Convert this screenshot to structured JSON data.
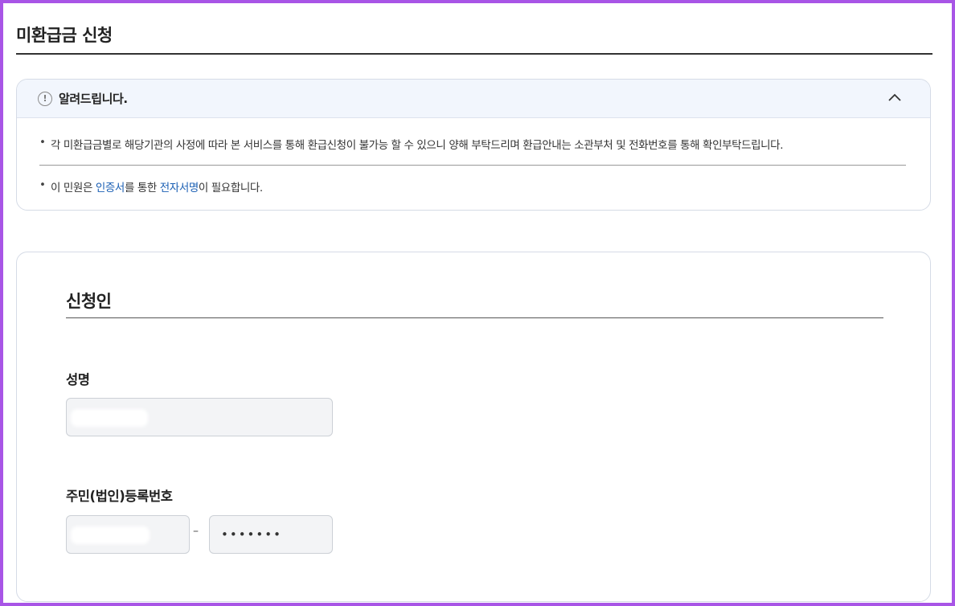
{
  "page": {
    "title": "미환급금 신청"
  },
  "notice": {
    "title": "알려드립니다.",
    "icon_text": "!",
    "item1": "각 미환급금별로 해당기관의 사정에 따라 본 서비스를 통해 환급신청이 불가능 할 수 있으니 양해 부탁드리며 환급안내는 소관부처 및 전화번호를 통해 확인부탁드립니다.",
    "item2_prefix": "이 민원은 ",
    "item2_link1": "인증서",
    "item2_middle": "를 통한 ",
    "item2_link2": "전자서명",
    "item2_suffix": "이 필요합니다."
  },
  "applicant": {
    "section_title": "신청인",
    "name_label": "성명",
    "name_value": "",
    "rrn_label": "주민(법인)등록번호",
    "rrn_front_value": "",
    "rrn_separator": "–",
    "rrn_back_value": "•••••••"
  },
  "colors": {
    "frame": "#a855e6",
    "link": "#1a5fb4",
    "notice_header_bg": "#f2f6fd"
  }
}
